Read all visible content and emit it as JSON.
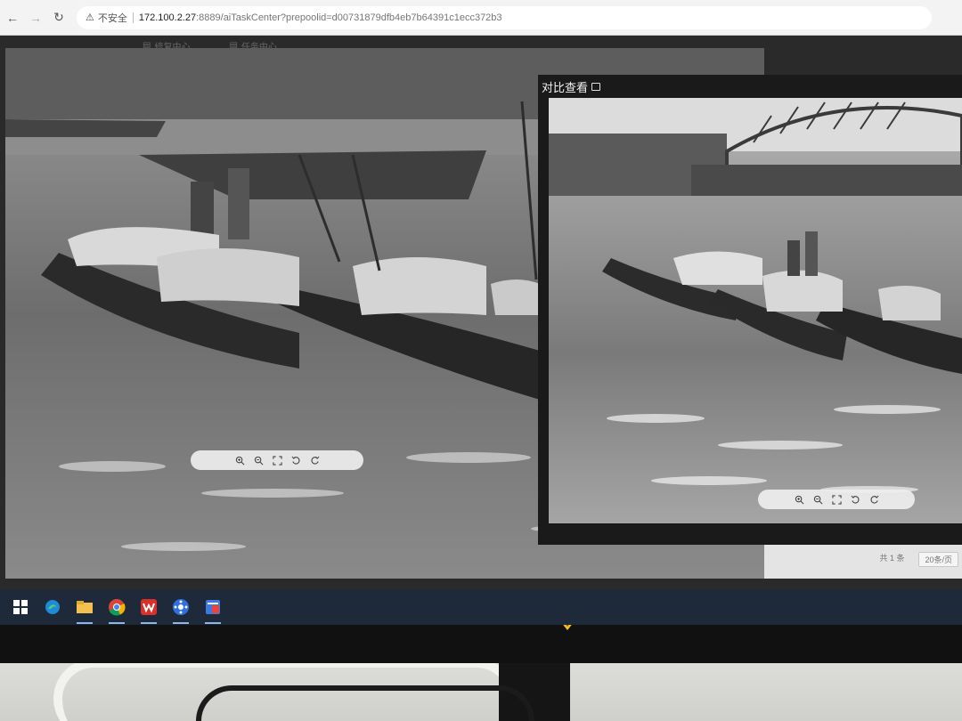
{
  "browser": {
    "security_label": "不安全",
    "url_host": "172.100.2.27",
    "url_rest": ":8889/aiTaskCenter?prepoolid=d00731879dfb4eb7b64391c1ecc372b3"
  },
  "page": {
    "tabs": [
      {
        "label": "修复中心"
      },
      {
        "label": "任务中心"
      }
    ]
  },
  "modal": {
    "title": "对比查看"
  },
  "pager": {
    "total_label": "共 1 条",
    "page_size": "20条/页"
  },
  "toolbar_icons": [
    "zoom-in-icon",
    "zoom-out-icon",
    "fullscreen-icon",
    "rotate-left-icon",
    "rotate-right-icon"
  ],
  "taskbar": {
    "apps": [
      "windows-start-icon",
      "edge-browser-icon",
      "file-explorer-icon",
      "chrome-browser-icon",
      "wps-office-icon",
      "media-app-icon",
      "calendar-app-icon"
    ]
  },
  "colors": {
    "taskbar": "#1e2a3a",
    "modal_background": "#1a1a1a",
    "page_background": "#2a2a2a"
  }
}
